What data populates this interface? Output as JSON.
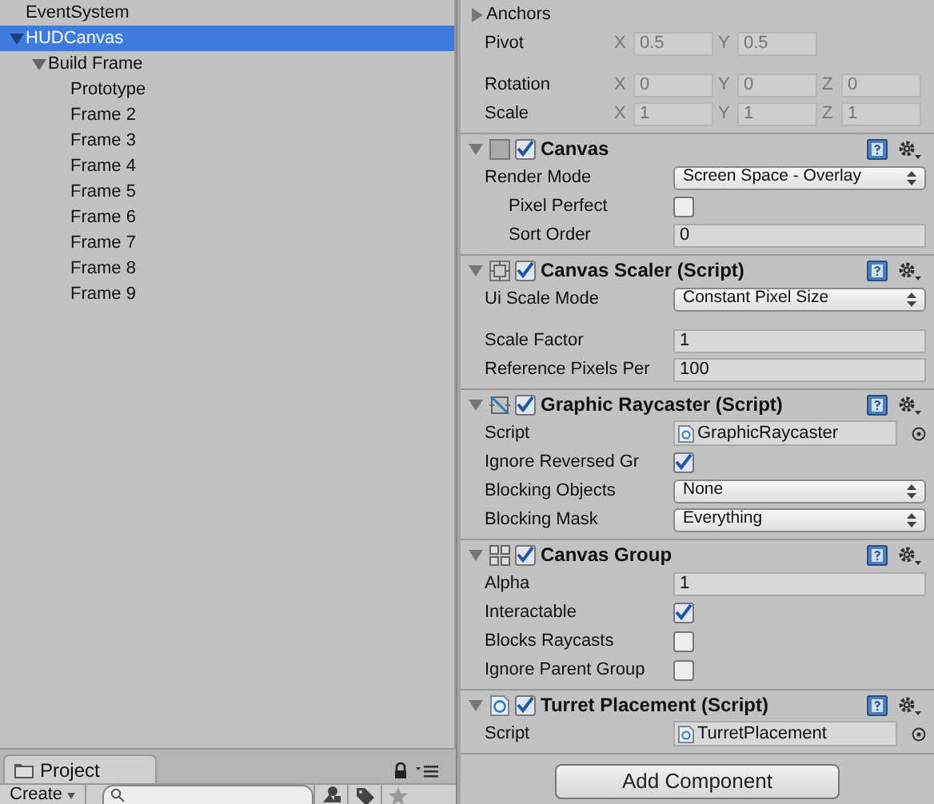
{
  "hierarchy": [
    {
      "label": "EventSystem",
      "selected": false
    },
    {
      "label": "HUDCanvas",
      "selected": true,
      "expanded": true,
      "children": [
        {
          "label": "Build Frame",
          "selected": false,
          "expanded": true,
          "children": [
            {
              "label": "Prototype",
              "selected": false
            },
            {
              "label": "Frame 2",
              "selected": false
            },
            {
              "label": "Frame 3",
              "selected": false
            },
            {
              "label": "Frame 4",
              "selected": false
            },
            {
              "label": "Frame 5",
              "selected": false
            },
            {
              "label": "Frame 6",
              "selected": false
            },
            {
              "label": "Frame 7",
              "selected": false
            },
            {
              "label": "Frame 8",
              "selected": false
            },
            {
              "label": "Frame 9",
              "selected": false
            }
          ]
        }
      ]
    }
  ],
  "project_panel": {
    "tab": "Project",
    "create_button": "Create"
  },
  "transform": {
    "anchors": {
      "label": "Anchors",
      "expanded": false
    },
    "rows": [
      {
        "label": "Pivot",
        "gap_before": false,
        "fields": [
          {
            "axis": "X",
            "value": "0.5"
          },
          {
            "axis": "Y",
            "value": "0.5"
          }
        ]
      },
      {
        "label": "Rotation",
        "gap_before": true,
        "fields": [
          {
            "axis": "X",
            "value": "0"
          },
          {
            "axis": "Y",
            "value": "0"
          },
          {
            "axis": "Z",
            "value": "0"
          }
        ]
      },
      {
        "label": "Scale",
        "gap_before": false,
        "fields": [
          {
            "axis": "X",
            "value": "1"
          },
          {
            "axis": "Y",
            "value": "1"
          },
          {
            "axis": "Z",
            "value": "1"
          }
        ]
      }
    ]
  },
  "components": [
    {
      "title": "Canvas",
      "kind": "canvas",
      "enabled": true,
      "expanded": true,
      "properties": [
        {
          "label": "Render Mode",
          "kind": "dropdown",
          "value": "Screen Space - Overlay",
          "indented": false,
          "gap_before": false
        },
        {
          "label": "Pixel Perfect",
          "kind": "checkbox",
          "checked": false,
          "indented": true,
          "gap_before": false
        },
        {
          "label": "Sort Order",
          "kind": "text",
          "value": "0",
          "indented": true,
          "gap_before": false
        }
      ]
    },
    {
      "title": "Canvas Scaler (Script)",
      "kind": "scaler",
      "enabled": true,
      "expanded": true,
      "properties": [
        {
          "label": "Ui Scale Mode",
          "kind": "dropdown",
          "value": "Constant Pixel Size",
          "indented": false,
          "gap_before": false
        },
        {
          "label": "Scale Factor",
          "kind": "text",
          "value": "1",
          "indented": false,
          "gap_before": true
        },
        {
          "label": "Reference Pixels Per",
          "kind": "text",
          "value": "100",
          "indented": false,
          "gap_before": false
        }
      ]
    },
    {
      "title": "Graphic Raycaster (Script)",
      "kind": "raycaster",
      "enabled": true,
      "expanded": true,
      "properties": [
        {
          "label": "Script",
          "kind": "object",
          "value": "GraphicRaycaster",
          "indented": false,
          "gap_before": false
        },
        {
          "label": "Ignore Reversed Gr",
          "kind": "checkbox",
          "checked": true,
          "indented": false,
          "gap_before": false
        },
        {
          "label": "Blocking Objects",
          "kind": "dropdown",
          "value": "None",
          "indented": false,
          "gap_before": false
        },
        {
          "label": "Blocking Mask",
          "kind": "dropdown",
          "value": "Everything",
          "indented": false,
          "gap_before": false
        }
      ]
    },
    {
      "title": "Canvas Group",
      "kind": "group",
      "enabled": true,
      "expanded": true,
      "properties": [
        {
          "label": "Alpha",
          "kind": "text",
          "value": "1",
          "indented": false,
          "gap_before": false
        },
        {
          "label": "Interactable",
          "kind": "checkbox",
          "checked": true,
          "indented": false,
          "gap_before": false
        },
        {
          "label": "Blocks Raycasts",
          "kind": "checkbox",
          "checked": false,
          "indented": false,
          "gap_before": false
        },
        {
          "label": "Ignore Parent Group",
          "kind": "checkbox",
          "checked": false,
          "indented": false,
          "gap_before": false
        }
      ]
    },
    {
      "title": "Turret Placement (Script)",
      "kind": "script",
      "enabled": true,
      "expanded": true,
      "properties": [
        {
          "label": "Script",
          "kind": "object",
          "value": "TurretPlacement",
          "indented": false,
          "gap_before": false
        }
      ]
    }
  ],
  "add_component_button": "Add Component"
}
